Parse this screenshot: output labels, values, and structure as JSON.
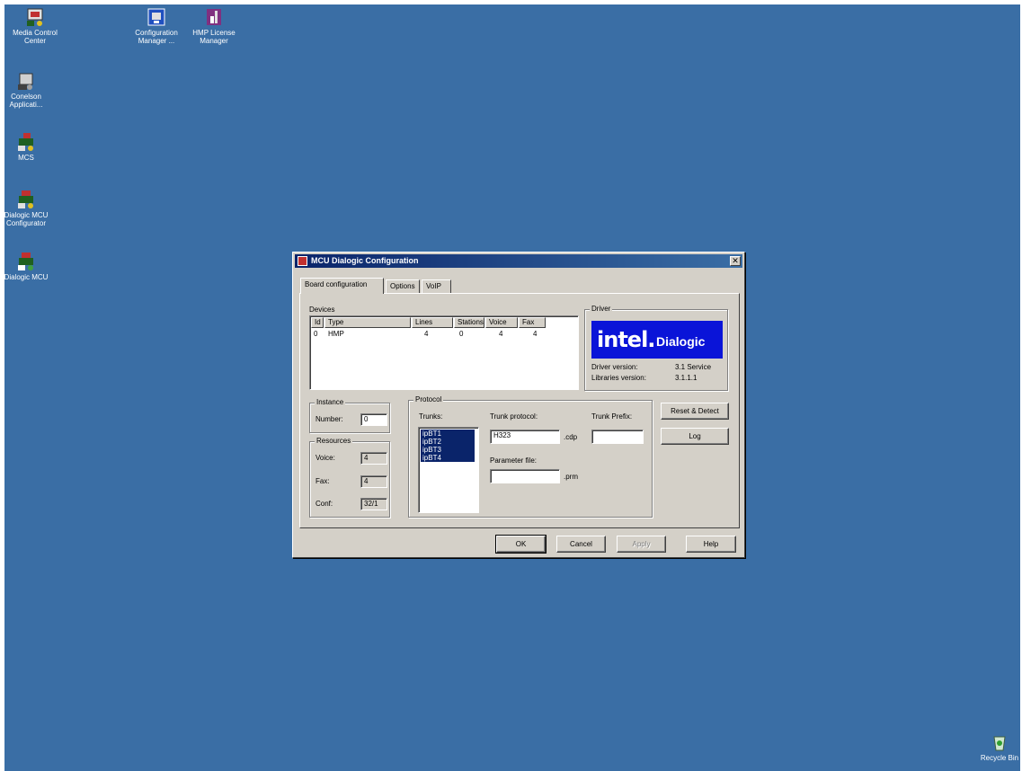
{
  "desktop": {
    "icons": [
      {
        "label": "Media Control\nCenter",
        "icon": "media-control-icon"
      },
      {
        "label": "Configuration\nManager ...",
        "icon": "config-manager-icon"
      },
      {
        "label": "HMP License\nManager",
        "icon": "license-manager-icon"
      },
      {
        "label": "Conelson\nApplicati...",
        "icon": "application-icon"
      },
      {
        "label": "MCS",
        "icon": "mcs-icon"
      },
      {
        "label": "Dialogic MCU\nConfigurator",
        "icon": "mcu-configurator-icon"
      },
      {
        "label": "Dialogic MCU",
        "icon": "dialogic-mcu-icon"
      },
      {
        "label": "Recycle Bin",
        "icon": "recycle-bin-icon"
      }
    ]
  },
  "dialog": {
    "title": "MCU Dialogic Configuration",
    "close_glyph": "✕",
    "tabs": [
      "Board configuration",
      "Options",
      "VoIP"
    ],
    "devices": {
      "group_label": "Devices",
      "columns": [
        "Id",
        "Type",
        "Lines",
        "Stations",
        "Voice",
        "Fax"
      ],
      "rows": [
        [
          "0",
          "HMP",
          "4",
          "0",
          "4",
          "4"
        ]
      ]
    },
    "driver": {
      "group_label": "Driver",
      "logo_intel": "intel.",
      "logo_brand": "Dialogic",
      "driver_version_label": "Driver version:",
      "driver_version_value": "3.1 Service",
      "libraries_version_label": "Libraries version:",
      "libraries_version_value": "3.1.1.1"
    },
    "instance": {
      "group_label": "Instance",
      "number_label": "Number:",
      "number_value": "0"
    },
    "resources": {
      "group_label": "Resources",
      "voice_label": "Voice:",
      "voice_value": "4",
      "fax_label": "Fax:",
      "fax_value": "4",
      "conf_label": "Conf:",
      "conf_value": "32/1"
    },
    "protocol": {
      "group_label": "Protocol",
      "trunks_label": "Trunks:",
      "trunks": [
        "ipBT1",
        "ipBT2",
        "ipBT3",
        "ipBT4"
      ],
      "trunk_protocol_label": "Trunk protocol:",
      "trunk_protocol_value": "H323",
      "cdp_suffix": ".cdp",
      "trunk_prefix_label": "Trunk Prefix:",
      "trunk_prefix_value": "",
      "parameter_file_label": "Parameter file:",
      "parameter_file_value": "",
      "prm_suffix": ".prm"
    },
    "side_buttons": {
      "reset_detect": "Reset & Detect",
      "log": "Log"
    },
    "buttons": {
      "ok": "OK",
      "cancel": "Cancel",
      "apply": "Apply",
      "help": "Help"
    }
  },
  "colors": {
    "desktop": "#3a6ea5",
    "titlebar": "#0a246a",
    "dialog_face": "#d4d0c8",
    "dialogic_logo": "#0a14d8"
  }
}
